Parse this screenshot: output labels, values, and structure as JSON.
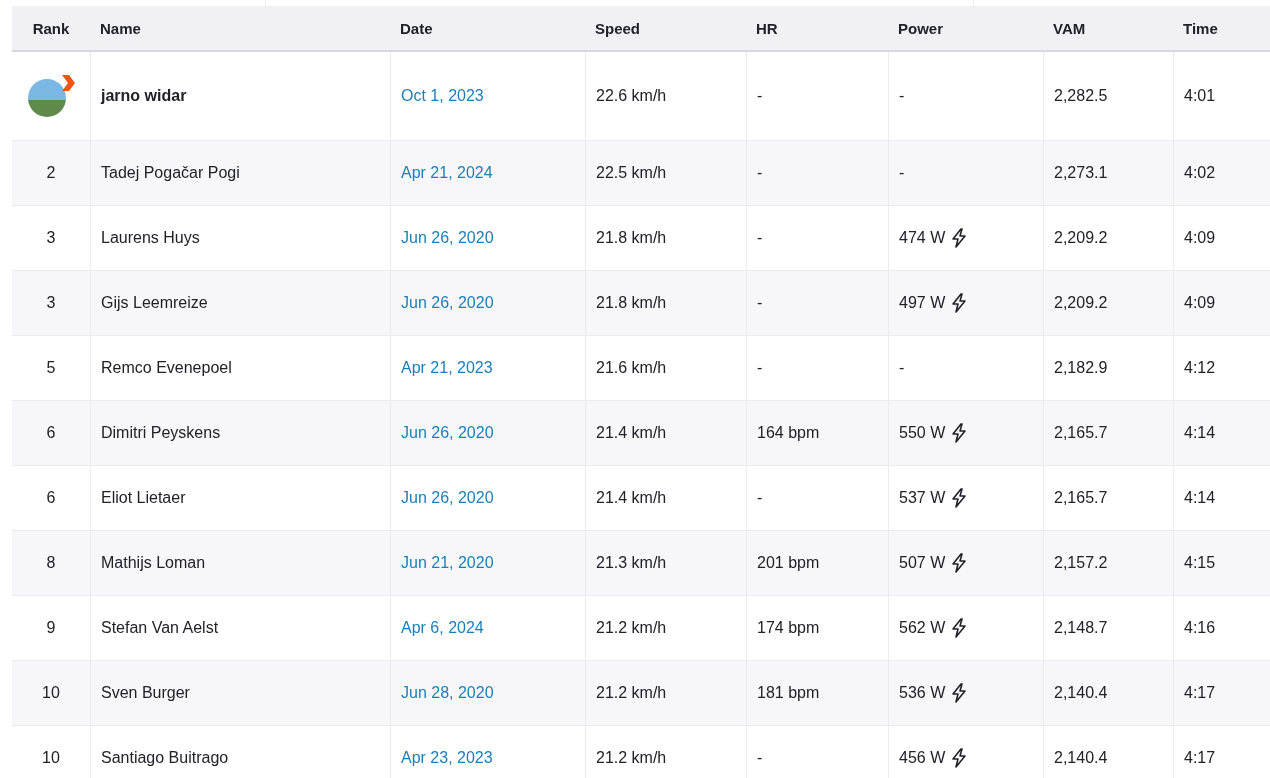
{
  "table": {
    "columns": [
      "Rank",
      "Name",
      "Date",
      "Speed",
      "HR",
      "Power",
      "VAM",
      "Time"
    ],
    "rows": [
      {
        "kind": "athlete",
        "rank": "",
        "name": "jarno widar",
        "date": "Oct 1, 2023",
        "speed": "22.6 km/h",
        "hr": "-",
        "power": "-",
        "power_meter": false,
        "vam": "2,282.5",
        "time": "4:01"
      },
      {
        "kind": "rank",
        "rank": "2",
        "name": "Tadej Pogačar Pogi",
        "date": "Apr 21, 2024",
        "speed": "22.5 km/h",
        "hr": "-",
        "power": "-",
        "power_meter": false,
        "vam": "2,273.1",
        "time": "4:02"
      },
      {
        "kind": "rank",
        "rank": "3",
        "name": "Laurens Huys",
        "date": "Jun 26, 2020",
        "speed": "21.8 km/h",
        "hr": "-",
        "power": "474 W",
        "power_meter": true,
        "vam": "2,209.2",
        "time": "4:09"
      },
      {
        "kind": "rank",
        "rank": "3",
        "name": "Gijs Leemreize",
        "date": "Jun 26, 2020",
        "speed": "21.8 km/h",
        "hr": "-",
        "power": "497 W",
        "power_meter": true,
        "vam": "2,209.2",
        "time": "4:09"
      },
      {
        "kind": "rank",
        "rank": "5",
        "name": "Remco Evenepoel",
        "date": "Apr 21, 2023",
        "speed": "21.6 km/h",
        "hr": "-",
        "power": "-",
        "power_meter": false,
        "vam": "2,182.9",
        "time": "4:12"
      },
      {
        "kind": "rank",
        "rank": "6",
        "name": "Dimitri Peyskens",
        "date": "Jun 26, 2020",
        "speed": "21.4 km/h",
        "hr": "164 bpm",
        "power": "550 W",
        "power_meter": true,
        "vam": "2,165.7",
        "time": "4:14"
      },
      {
        "kind": "rank",
        "rank": "6",
        "name": "Eliot Lietaer",
        "date": "Jun 26, 2020",
        "speed": "21.4 km/h",
        "hr": "-",
        "power": "537 W",
        "power_meter": true,
        "vam": "2,165.7",
        "time": "4:14"
      },
      {
        "kind": "rank",
        "rank": "8",
        "name": "Mathijs Loman",
        "date": "Jun 21, 2020",
        "speed": "21.3 km/h",
        "hr": "201 bpm",
        "power": "507 W",
        "power_meter": true,
        "vam": "2,157.2",
        "time": "4:15"
      },
      {
        "kind": "rank",
        "rank": "9",
        "name": "Stefan Van Aelst",
        "date": "Apr 6, 2024",
        "speed": "21.2 km/h",
        "hr": "174 bpm",
        "power": "562 W",
        "power_meter": true,
        "vam": "2,148.7",
        "time": "4:16"
      },
      {
        "kind": "rank",
        "rank": "10",
        "name": "Sven Burger",
        "date": "Jun 28, 2020",
        "speed": "21.2 km/h",
        "hr": "181 bpm",
        "power": "536 W",
        "power_meter": true,
        "vam": "2,140.4",
        "time": "4:17"
      },
      {
        "kind": "rank",
        "rank": "10",
        "name": "Santiago Buitrago",
        "date": "Apr 23, 2023",
        "speed": "21.2 km/h",
        "hr": "-",
        "power": "456 W",
        "power_meter": true,
        "vam": "2,140.4",
        "time": "4:17"
      }
    ]
  }
}
